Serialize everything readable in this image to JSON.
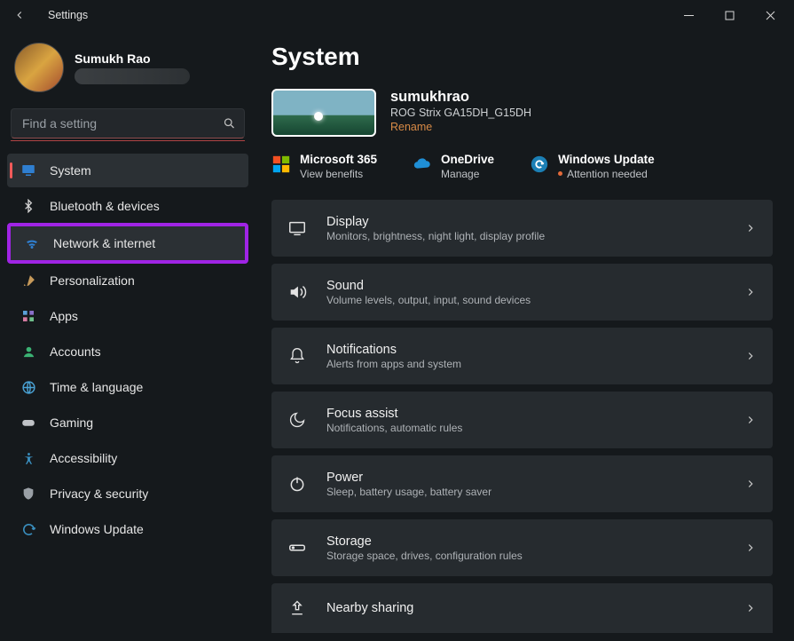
{
  "app": {
    "title": "Settings"
  },
  "profile": {
    "name": "Sumukh Rao"
  },
  "search": {
    "placeholder": "Find a setting"
  },
  "sidebar": {
    "items": [
      {
        "id": "system",
        "label": "System",
        "icon": "monitor-icon",
        "selected": true
      },
      {
        "id": "bluetooth",
        "label": "Bluetooth & devices",
        "icon": "bluetooth-icon"
      },
      {
        "id": "network",
        "label": "Network & internet",
        "icon": "wifi-icon",
        "highlighted": true
      },
      {
        "id": "personal",
        "label": "Personalization",
        "icon": "brush-icon"
      },
      {
        "id": "apps",
        "label": "Apps",
        "icon": "apps-icon"
      },
      {
        "id": "accounts",
        "label": "Accounts",
        "icon": "person-icon"
      },
      {
        "id": "time",
        "label": "Time & language",
        "icon": "globe-icon"
      },
      {
        "id": "gaming",
        "label": "Gaming",
        "icon": "gamepad-icon"
      },
      {
        "id": "access",
        "label": "Accessibility",
        "icon": "accessibility-icon"
      },
      {
        "id": "privacy",
        "label": "Privacy & security",
        "icon": "shield-icon"
      },
      {
        "id": "update",
        "label": "Windows Update",
        "icon": "update-icon"
      }
    ]
  },
  "page": {
    "title": "System",
    "device": {
      "name": "sumukhrao",
      "model": "ROG Strix GA15DH_G15DH",
      "rename": "Rename"
    },
    "status": [
      {
        "id": "m365",
        "title": "Microsoft 365",
        "sub": "View benefits",
        "icon": "microsoft-icon"
      },
      {
        "id": "onedrive",
        "title": "OneDrive",
        "sub": "Manage",
        "icon": "cloud-icon"
      },
      {
        "id": "wu",
        "title": "Windows Update",
        "sub": "Attention needed",
        "icon": "update-circle-icon",
        "attention": true
      }
    ],
    "cards": [
      {
        "id": "display",
        "title": "Display",
        "sub": "Monitors, brightness, night light, display profile",
        "icon": "display-icon"
      },
      {
        "id": "sound",
        "title": "Sound",
        "sub": "Volume levels, output, input, sound devices",
        "icon": "sound-icon"
      },
      {
        "id": "notif",
        "title": "Notifications",
        "sub": "Alerts from apps and system",
        "icon": "bell-icon"
      },
      {
        "id": "focus",
        "title": "Focus assist",
        "sub": "Notifications, automatic rules",
        "icon": "moon-icon"
      },
      {
        "id": "power",
        "title": "Power",
        "sub": "Sleep, battery usage, battery saver",
        "icon": "power-icon"
      },
      {
        "id": "storage",
        "title": "Storage",
        "sub": "Storage space, drives, configuration rules",
        "icon": "storage-icon"
      },
      {
        "id": "nearby",
        "title": "Nearby sharing",
        "sub": "",
        "icon": "share-icon"
      }
    ]
  }
}
